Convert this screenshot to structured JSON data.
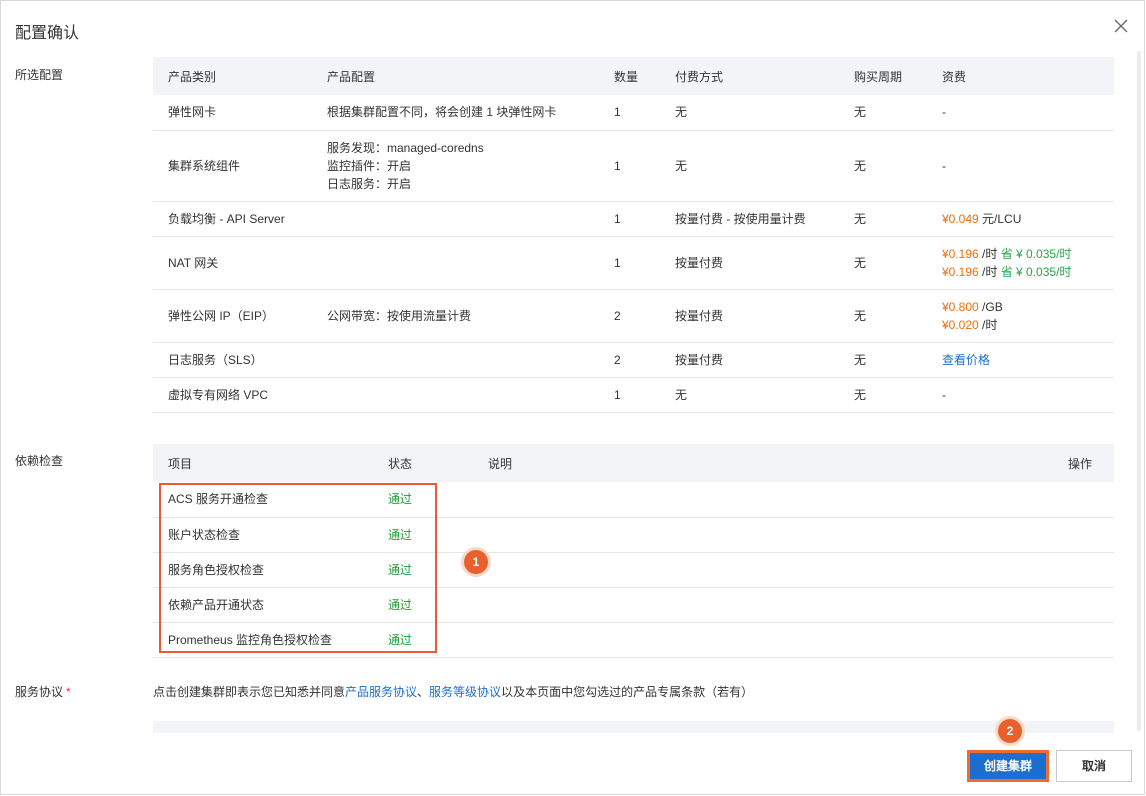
{
  "dialog": {
    "title": "配置确认"
  },
  "labels": {
    "selected_config": "所选配置",
    "dependency_check": "依赖检查",
    "service_agreement": "服务协议",
    "required_mark": "*"
  },
  "config_table": {
    "headers": [
      "产品类别",
      "产品配置",
      "数量",
      "付费方式",
      "购买周期",
      "资费"
    ],
    "rows": [
      {
        "category": "弹性网卡",
        "config": [
          "根据集群配置不同，将会创建 1 块弹性网卡"
        ],
        "qty": "1",
        "pay": "无",
        "period": "无",
        "fee": [
          {
            "text": "-"
          }
        ]
      },
      {
        "category": "集群系统组件",
        "config": [
          "服务发现：managed-coredns",
          "监控插件：开启",
          "日志服务：开启"
        ],
        "qty": "1",
        "pay": "无",
        "period": "无",
        "fee": [
          {
            "text": "-"
          }
        ]
      },
      {
        "category": "负载均衡 - API Server",
        "config": [],
        "qty": "1",
        "pay": "按量付费 - 按使用量计费",
        "period": "无",
        "fee": [
          {
            "price": "¥0.049",
            "unit": " 元/LCU"
          }
        ]
      },
      {
        "category": "NAT 网关",
        "config": [],
        "qty": "1",
        "pay": "按量付费",
        "period": "无",
        "fee": [
          {
            "price": "¥0.196",
            "unit": " /时",
            "save": " 省 ¥ 0.035/时"
          },
          {
            "price": "¥0.196",
            "unit": " /时",
            "save": " 省 ¥ 0.035/时"
          }
        ]
      },
      {
        "category": "弹性公网 IP（EIP）",
        "config": [
          "公网带宽：按使用流量计费"
        ],
        "qty": "2",
        "pay": "按量付费",
        "period": "无",
        "fee": [
          {
            "price": "¥0.800",
            "unit": " /GB"
          },
          {
            "price": "¥0.020",
            "unit": " /时"
          }
        ]
      },
      {
        "category": "日志服务（SLS）",
        "config": [],
        "qty": "2",
        "pay": "按量付费",
        "period": "无",
        "fee": [
          {
            "link": "查看价格"
          }
        ]
      },
      {
        "category": "虚拟专有网络 VPC",
        "config": [],
        "qty": "1",
        "pay": "无",
        "period": "无",
        "fee": [
          {
            "text": "-"
          }
        ]
      }
    ]
  },
  "dep_table": {
    "headers": [
      "项目",
      "状态",
      "说明",
      "操作"
    ],
    "rows": [
      {
        "item": "ACS 服务开通检查",
        "status": "通过"
      },
      {
        "item": "账户状态检查",
        "status": "通过"
      },
      {
        "item": "服务角色授权检查",
        "status": "通过"
      },
      {
        "item": "依赖产品开通状态",
        "status": "通过"
      },
      {
        "item": "Prometheus 监控角色授权检查",
        "status": "通过"
      }
    ]
  },
  "agreement": {
    "prefix": "点击创建集群即表示您已知悉并同意",
    "link1": "产品服务协议",
    "sep": "、",
    "link2": "服务等级协议",
    "suffix": "以及本页面中您勾选过的产品专属条款（若有）"
  },
  "badges": {
    "one": "1",
    "two": "2"
  },
  "buttons": {
    "create": "创建集群",
    "cancel": "取消"
  },
  "colors": {
    "accent": "#1a6fd1",
    "price": "#f56c06",
    "saving": "#29a34a",
    "highlight": "#e85a3a"
  }
}
